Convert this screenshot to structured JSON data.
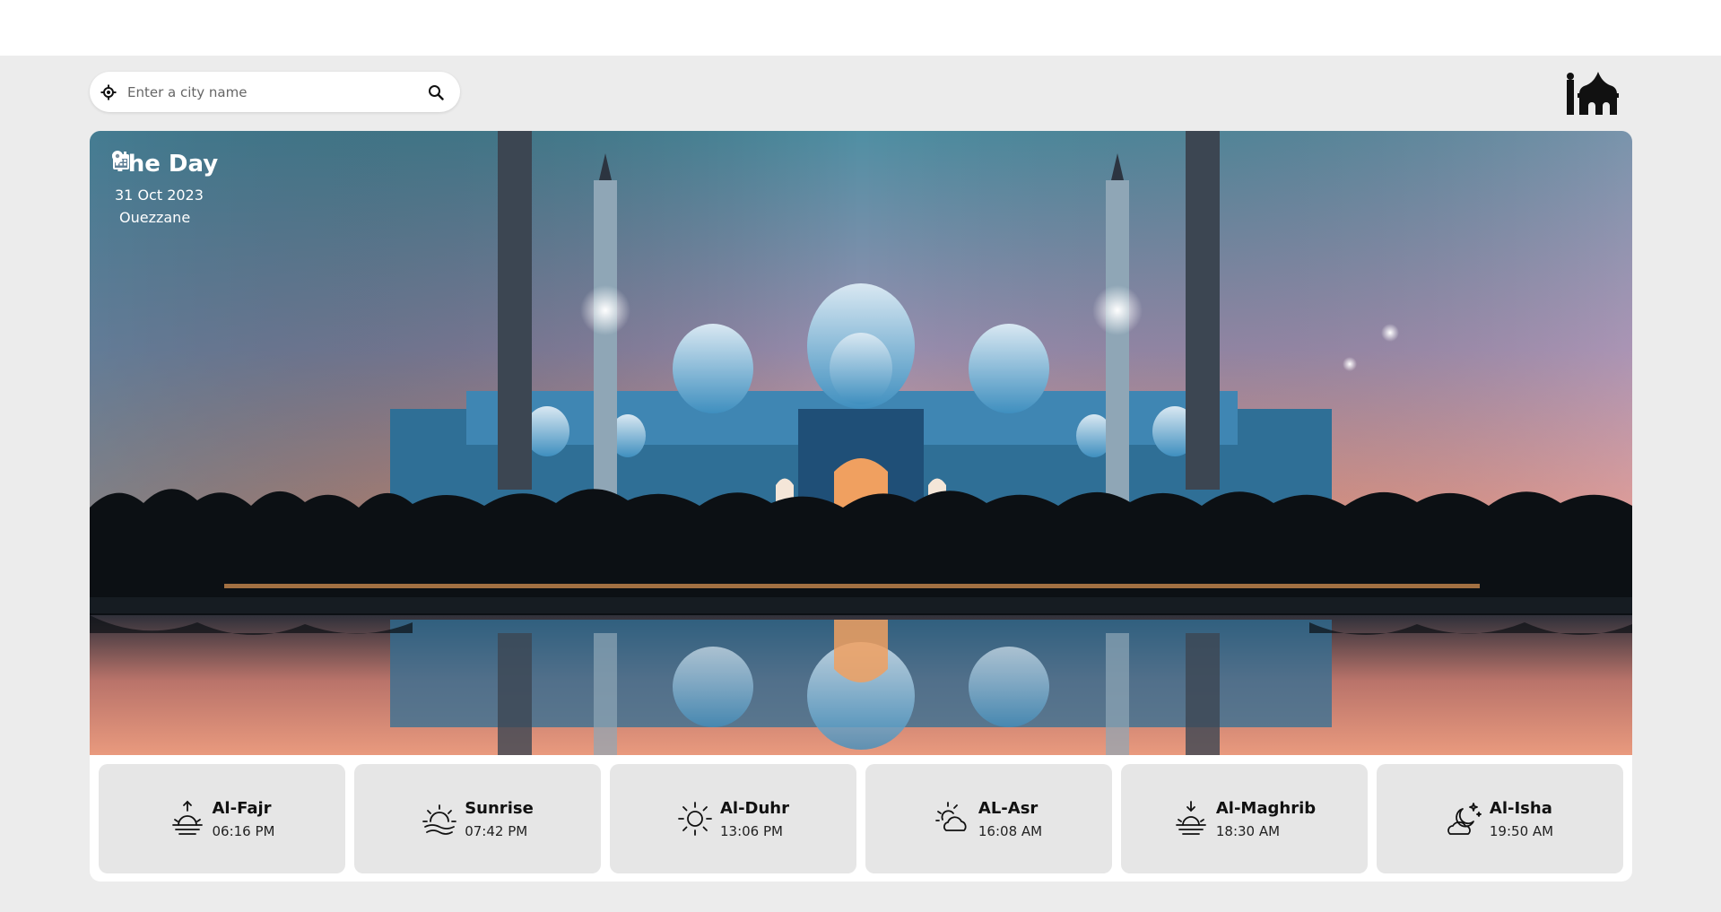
{
  "search": {
    "placeholder": "Enter a city name"
  },
  "day": {
    "title": "The Day",
    "date": "31 Oct 2023",
    "city": "Ouezzane"
  },
  "prayers": [
    {
      "name": "Al-Fajr",
      "time": "06:16 PM",
      "icon": "fajr-icon"
    },
    {
      "name": "Sunrise",
      "time": "07:42 PM",
      "icon": "sunrise-icon"
    },
    {
      "name": "Al-Duhr",
      "time": "13:06 PM",
      "icon": "sun-icon"
    },
    {
      "name": "AL-Asr",
      "time": "16:08 AM",
      "icon": "sun-cloud-icon"
    },
    {
      "name": "Al-Maghrib",
      "time": "18:30 AM",
      "icon": "sunset-icon"
    },
    {
      "name": "Al-Isha",
      "time": "19:50 AM",
      "icon": "moon-cloud-icon"
    }
  ],
  "colors": {
    "page_bg": "#ececec",
    "card_bg": "#ffffff",
    "prayer_bg": "#e6e6e6",
    "sky_top": "#4f8fa3",
    "sky_bottom": "#f2937a"
  }
}
